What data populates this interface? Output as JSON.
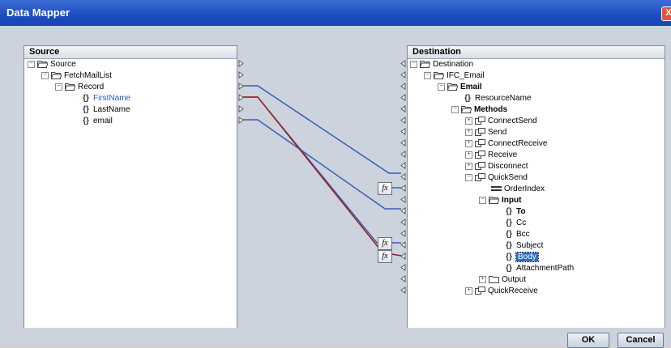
{
  "window": {
    "title": "Data Mapper",
    "close_label": "X"
  },
  "source": {
    "header": "Source",
    "nodes": [
      {
        "label": "Source"
      },
      {
        "label": "FetchMailList"
      },
      {
        "label": "Record"
      },
      {
        "label": "FirstName"
      },
      {
        "label": "LastName"
      },
      {
        "label": "email"
      }
    ]
  },
  "destination": {
    "header": "Destination",
    "nodes": [
      {
        "label": "Destination"
      },
      {
        "label": "IFC_Email"
      },
      {
        "label": "Email"
      },
      {
        "label": "ResourceName"
      },
      {
        "label": "Methods"
      },
      {
        "label": "ConnectSend"
      },
      {
        "label": "Send"
      },
      {
        "label": "ConnectReceive"
      },
      {
        "label": "Receive"
      },
      {
        "label": "Disconnect"
      },
      {
        "label": "QuickSend"
      },
      {
        "label": "OrderIndex"
      },
      {
        "label": "Input"
      },
      {
        "label": "To"
      },
      {
        "label": "Cc"
      },
      {
        "label": "Bcc"
      },
      {
        "label": "Subject"
      },
      {
        "label": "Body"
      },
      {
        "label": "AttachmentPath"
      },
      {
        "label": "Output"
      },
      {
        "label": "QuickReceive"
      }
    ]
  },
  "functions": {
    "fx_label": "fx"
  },
  "buttons": {
    "ok": "OK",
    "cancel": "Cancel"
  },
  "colors": {
    "mapping_blue": "#3a5bb8",
    "mapping_red": "#9b1c1c",
    "title_bar": "#1d4cc0"
  }
}
